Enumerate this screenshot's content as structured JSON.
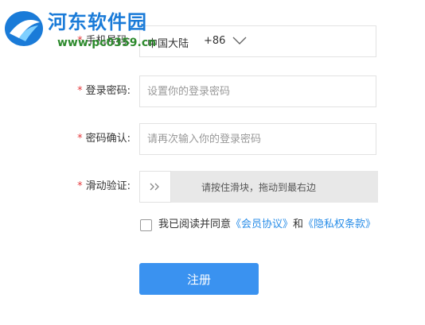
{
  "watermark": {
    "title": "河东软件园",
    "url": "www.pc0359.cn"
  },
  "form": {
    "phone": {
      "label": "手机号码:",
      "region_name": "中国大陆",
      "region_code": "+86",
      "value": ""
    },
    "password": {
      "label": "登录密码:",
      "placeholder": "设置你的登录密码",
      "value": ""
    },
    "confirm": {
      "label": "密码确认:",
      "placeholder": "请再次输入你的登录密码",
      "value": ""
    },
    "slider": {
      "label": "滑动验证:",
      "hint": "请按住滑块，拖动到最右边",
      "handle_icon": "double-chevron-right"
    },
    "agreement": {
      "prefix": "我已阅读并同意",
      "member_link": "《会员协议》",
      "and": "和",
      "privacy_link": "《隐私权条款》",
      "checked": false
    },
    "submit_label": "注册",
    "required_mark": "*"
  },
  "colors": {
    "accent": "#3a92f0",
    "link": "#2a8ee8",
    "required": "#e4393c",
    "watermark_title": "#1a7bd8",
    "watermark_url": "#2e8b2e"
  }
}
